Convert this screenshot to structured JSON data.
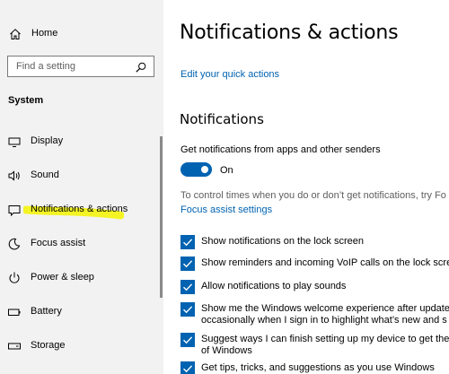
{
  "sidebar": {
    "home_label": "Home",
    "search_placeholder": "Find a setting",
    "section_title": "System",
    "items": [
      {
        "label": "Display",
        "icon": "display-icon"
      },
      {
        "label": "Sound",
        "icon": "sound-icon"
      },
      {
        "label": "Notifications & actions",
        "icon": "notifications-icon"
      },
      {
        "label": "Focus assist",
        "icon": "focus-assist-icon"
      },
      {
        "label": "Power & sleep",
        "icon": "power-icon"
      },
      {
        "label": "Battery",
        "icon": "battery-icon"
      },
      {
        "label": "Storage",
        "icon": "storage-icon"
      }
    ],
    "highlight_color": "#f4f400"
  },
  "main": {
    "title": "Notifications & actions",
    "quick_actions_link": "Edit your quick actions",
    "notifications_title": "Notifications",
    "get_notifications_label": "Get notifications from apps and other senders",
    "toggle_state": "On",
    "focus_description": "To control times when you do or don’t get notifications, try Fo",
    "focus_link": "Focus assist settings",
    "checkboxes": [
      {
        "line1": "Show notifications on the lock screen",
        "line2": "",
        "checked": true
      },
      {
        "line1": "Show reminders and incoming VoIP calls on the lock scree",
        "line2": "",
        "checked": true
      },
      {
        "line1": "Allow notifications to play sounds",
        "line2": "",
        "checked": true
      },
      {
        "line1": "Show me the Windows welcome experience after update",
        "line2": "occasionally when I sign in to highlight what’s new and s",
        "checked": true
      },
      {
        "line1": "Suggest ways I can finish setting up my device to get the",
        "line2": "of Windows",
        "checked": true
      },
      {
        "line1": "Get tips, tricks, and suggestions as you use Windows",
        "line2": "",
        "checked": true
      }
    ]
  },
  "colors": {
    "accent": "#0063b1",
    "sidebar_bg": "#f2f2f2"
  }
}
